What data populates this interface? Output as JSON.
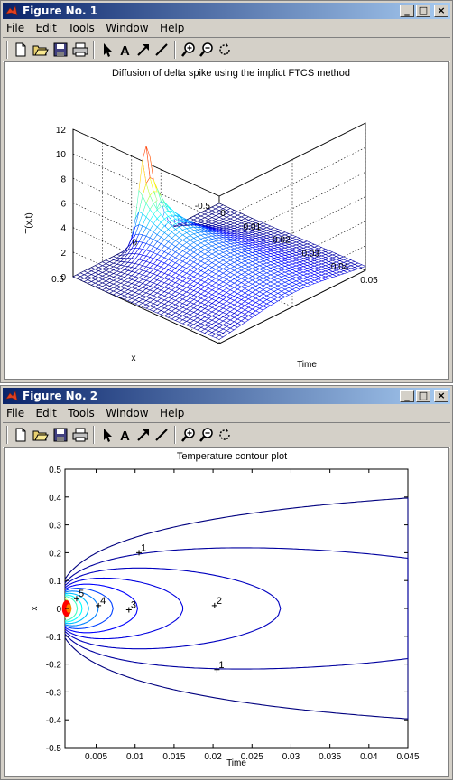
{
  "windows": [
    {
      "title": "Figure No. 1",
      "menu": [
        "File",
        "Edit",
        "Tools",
        "Window",
        "Help"
      ],
      "controls": [
        "minimize",
        "maximize",
        "close"
      ]
    },
    {
      "title": "Figure No. 2",
      "menu": [
        "File",
        "Edit",
        "Tools",
        "Window",
        "Help"
      ],
      "controls": [
        "minimize",
        "maximize",
        "close"
      ]
    }
  ],
  "toolbar_icons": [
    "new-file-icon",
    "open-folder-icon",
    "save-icon",
    "print-icon",
    "select-arrow-icon",
    "text-icon",
    "arrow-icon",
    "line-icon",
    "zoom-in-icon",
    "zoom-out-icon",
    "rotate-icon"
  ],
  "chart_data": [
    {
      "type": "surface",
      "title": "Diffusion of delta spike using the implict FTCS method",
      "xlabel": "Time",
      "ylabel": "x",
      "zlabel": "T(x,t)",
      "xlim": [
        0,
        0.05
      ],
      "ylim": [
        -0.5,
        0.5
      ],
      "zlim": [
        0,
        12
      ],
      "xticks": [
        "0",
        "0.01",
        "0.02",
        "0.03",
        "0.04",
        "0.05"
      ],
      "yticks": [
        "-0.5",
        "0",
        "0.5"
      ],
      "zticks": [
        "0",
        "2",
        "4",
        "6",
        "8",
        "10",
        "12"
      ],
      "peak": {
        "time": 0.0,
        "x": 0.0,
        "T": 7.2
      },
      "colormap": "jet",
      "grid": true
    },
    {
      "type": "contour",
      "title": "Temperature contour plot",
      "xlabel": "Time",
      "ylabel": "x",
      "xlim": [
        0.001,
        0.045
      ],
      "ylim": [
        -0.5,
        0.5
      ],
      "xticks": [
        "0.005",
        "0.01",
        "0.015",
        "0.02",
        "0.025",
        "0.03",
        "0.035",
        "0.04",
        "0.045"
      ],
      "yticks": [
        "0.5",
        "0.4",
        "0.3",
        "0.2",
        "0.1",
        "0",
        "-0.1",
        "-0.2",
        "-0.3",
        "-0.4",
        "-0.5"
      ],
      "levels": [
        {
          "value": 0.5,
          "color": "#00007f"
        },
        {
          "value": 1,
          "color": "#00009f",
          "label": "1"
        },
        {
          "value": 1.5,
          "color": "#0000bf"
        },
        {
          "value": 2,
          "color": "#0000df",
          "label": "2"
        },
        {
          "value": 2.5,
          "color": "#0000ff"
        },
        {
          "value": 3,
          "color": "#0040ff",
          "label": "3"
        },
        {
          "value": 3.5,
          "color": "#0080ff"
        },
        {
          "value": 4,
          "color": "#00bfff",
          "label": "4"
        },
        {
          "value": 4.5,
          "color": "#00ffff"
        },
        {
          "value": 5,
          "color": "#40ffbf",
          "label": "5"
        },
        {
          "value": 6,
          "color": "#bfff40"
        },
        {
          "value": 7,
          "color": "#ff8000"
        },
        {
          "value": 8,
          "color": "#ff0000"
        }
      ],
      "contour_labels": [
        {
          "text": "1",
          "time": 0.0105,
          "x": 0.2
        },
        {
          "text": "2",
          "time": 0.0202,
          "x": 0.01
        },
        {
          "text": "3",
          "time": 0.0092,
          "x": -0.005
        },
        {
          "text": "4",
          "time": 0.0053,
          "x": 0.01
        },
        {
          "text": "5",
          "time": 0.0025,
          "x": 0.035
        },
        {
          "text": "1",
          "time": 0.0205,
          "x": -0.22
        }
      ]
    }
  ]
}
